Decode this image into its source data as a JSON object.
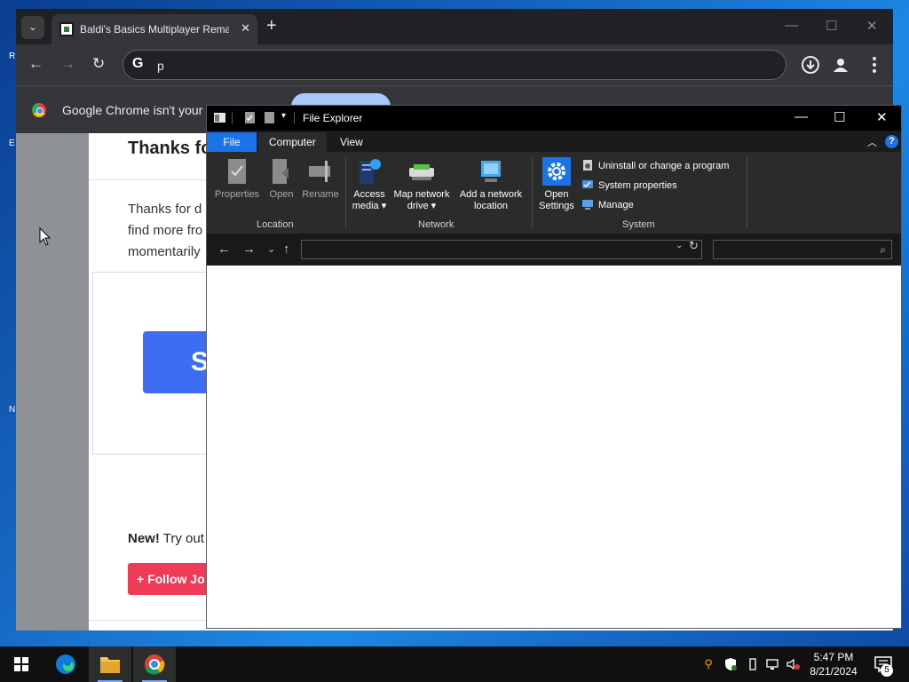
{
  "desktop": {
    "icon_labels": [
      "R",
      "E",
      "N"
    ]
  },
  "chrome": {
    "tab_title": "Baldi's Basics Multiplayer Remake",
    "tab_close": "✕",
    "new_tab": "+",
    "tab_menu": "⌄",
    "window_controls": {
      "minimize": "—",
      "maximize": "☐",
      "close": "✕"
    },
    "nav": {
      "back": "←",
      "forward": "→",
      "reload": "↻"
    },
    "omnibox_logo": "G",
    "omnibox_text": "p",
    "infobar_text": "Google Chrome isn't your de",
    "page": {
      "heading": "Thanks fo",
      "paragraph_lines": [
        "Thanks for d",
        "find more fro",
        "momentarily"
      ],
      "big_button": "S",
      "new_label": "New!",
      "new_text": " Try out",
      "follow_button": "+ Follow Jo"
    }
  },
  "explorer": {
    "title": "File Explorer",
    "window_controls": {
      "minimize": "—",
      "maximize": "☐",
      "close": "✕"
    },
    "tabs": {
      "file": "File",
      "computer": "Computer",
      "view": "View"
    },
    "help": "?",
    "collapse": "︿",
    "groups": {
      "location": {
        "label": "Location",
        "buttons": [
          "Properties",
          "Open",
          "Rename"
        ]
      },
      "network": {
        "label": "Network",
        "access_media": [
          "Access",
          "media ▾"
        ],
        "map_drive": [
          "Map network",
          "drive ▾"
        ],
        "add_location": [
          "Add a network",
          "location"
        ]
      },
      "system": {
        "label": "System",
        "open_settings": [
          "Open",
          "Settings"
        ],
        "items": [
          "Uninstall or change a program",
          "System properties",
          "Manage"
        ]
      }
    },
    "address_bar": {
      "back": "←",
      "forward": "→",
      "recent": "⌄",
      "up": "↑",
      "dropdown": "⌄",
      "refresh": "↻",
      "search_icon": "⌕",
      "path": "",
      "search_placeholder": ""
    }
  },
  "taskbar": {
    "time": "5:47 PM",
    "date": "8/21/2024",
    "notification_count": "5"
  },
  "colors": {
    "explorer_accent": "#1a73e8",
    "chrome_dark": "#202124",
    "follow_red": "#ef3b57",
    "page_button_blue": "#3d6df0"
  }
}
